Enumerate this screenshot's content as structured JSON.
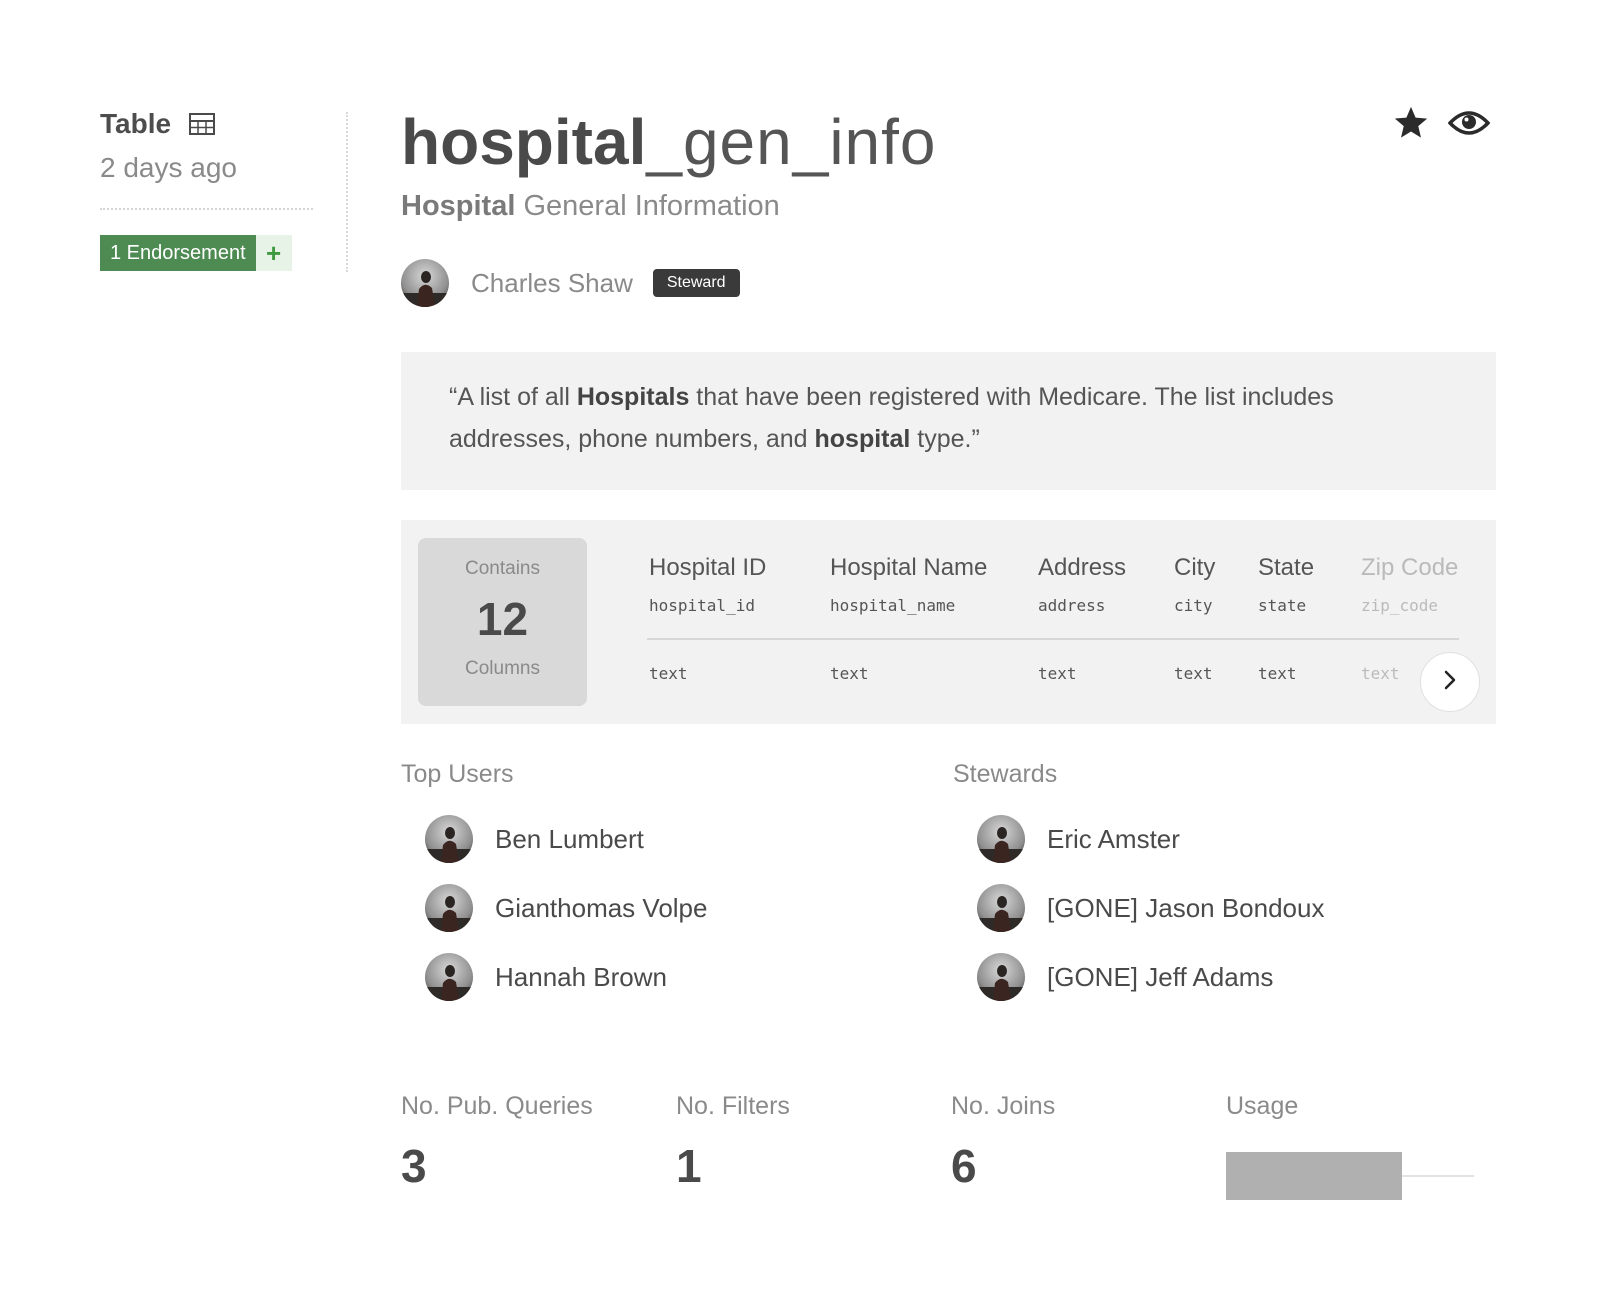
{
  "sidebar": {
    "type_label": "Table",
    "type_icon": "table-grid-icon",
    "modified": "2 days ago",
    "endorsement_label": "1 Endorsement",
    "endorse_add": "+"
  },
  "header": {
    "title_strong": "hospital",
    "title_rest": "_gen_info",
    "subtitle_strong": "Hospital",
    "subtitle_rest": " General Information",
    "star_icon": "star-icon",
    "watch_icon": "eye-icon"
  },
  "owner": {
    "name": "Charles Shaw",
    "badge": "Steward"
  },
  "description": {
    "open_quote": "“A list of all ",
    "bold1": "Hospitals",
    "mid": " that have been registered with Medicare. The list includes addresses, phone numbers, and ",
    "bold2": "hospital",
    "end": " type.”"
  },
  "columns": {
    "count_top": "Contains",
    "count": "12",
    "count_bottom": "Columns",
    "items": [
      {
        "name": "Hospital ID",
        "field": "hospital_id",
        "type": "text"
      },
      {
        "name": "Hospital Name",
        "field": "hospital_name",
        "type": "text"
      },
      {
        "name": "Address",
        "field": "address",
        "type": "text"
      },
      {
        "name": "City",
        "field": "city",
        "type": "text"
      },
      {
        "name": "State",
        "field": "state",
        "type": "text"
      },
      {
        "name": "Zip Code",
        "field": "zip_code",
        "type": "text"
      }
    ],
    "next_icon": "chevron-right-icon"
  },
  "top_users": {
    "title": "Top Users",
    "people": [
      "Ben Lumbert",
      "Gianthomas Volpe",
      "Hannah Brown"
    ]
  },
  "stewards": {
    "title": "Stewards",
    "people": [
      "Eric Amster",
      "[GONE] Jason Bondoux",
      "[GONE] Jeff Adams"
    ]
  },
  "stats": {
    "pub_queries_label": "No. Pub. Queries",
    "pub_queries": "3",
    "filters_label": "No. Filters",
    "filters": "1",
    "joins_label": "No. Joins",
    "joins": "6",
    "usage_label": "Usage",
    "usage_fraction": 0.71
  },
  "colors": {
    "endorse_green": "#4d8b52",
    "badge_dark": "#3a3a3a",
    "panel_bg": "#f2f2f2",
    "usage_fill": "#b0b0b0"
  }
}
